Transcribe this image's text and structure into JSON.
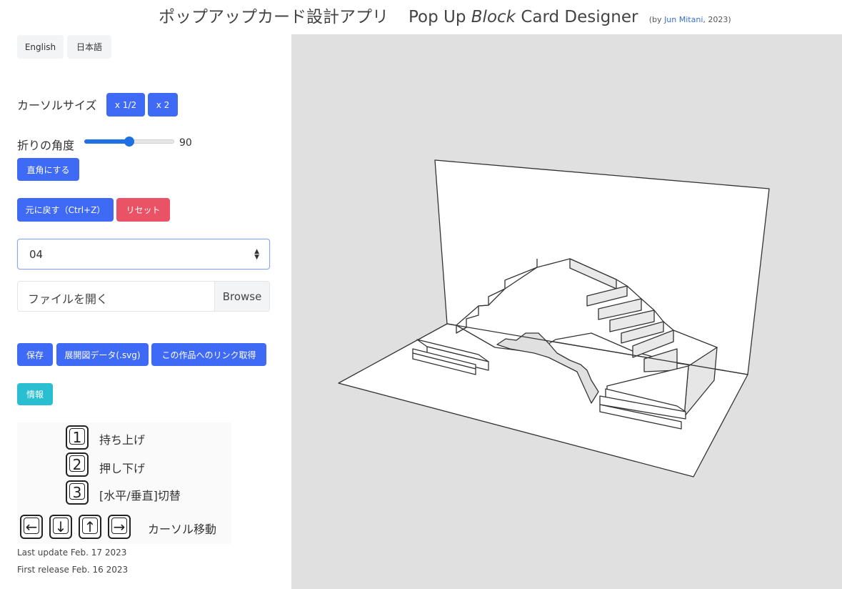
{
  "header": {
    "title_jp": "ポップアップカード設計アプリ",
    "title_pre": "Pop Up",
    "title_italic": "Block",
    "title_post": "Card Designer",
    "by_open": "(by",
    "author": "Jun Mitani",
    "by_close": ", 2023)"
  },
  "language": {
    "english": "English",
    "japanese": "日本語"
  },
  "cursor_size": {
    "label": "カーソルサイズ",
    "half": "x 1/2",
    "double": "x 2"
  },
  "fold_angle": {
    "label": "折りの角度",
    "value": 90,
    "fraction": 0.5,
    "right_angle_button": "直角にする"
  },
  "history": {
    "undo": "元に戻す（Ctrl+Z）",
    "reset": "リセット"
  },
  "model_select": {
    "selected": "04"
  },
  "file_input": {
    "placeholder": "ファイルを開く",
    "browse": "Browse"
  },
  "actions": {
    "save": "保存",
    "export_svg": "展開図データ(.svg)",
    "get_link": "この作品へのリンク取得",
    "info": "情報"
  },
  "key_guide": {
    "key1": "1",
    "key1_label": "持ち上げ",
    "key2": "2",
    "key2_label": "押し下げ",
    "key3": "3",
    "key3_label": "[水平/垂直]切替",
    "left": "←",
    "down": "↓",
    "up": "↑",
    "right": "→",
    "arrows_label": "カーソル移動"
  },
  "footer": {
    "last_update": "Last update Feb. 17 2023",
    "first_release": "First release Feb. 16 2023"
  },
  "colors": {
    "primary": "#3f6af5",
    "danger": "#ea5266",
    "info": "#29bfd0",
    "canvas_bg": "#e0e0e0"
  }
}
